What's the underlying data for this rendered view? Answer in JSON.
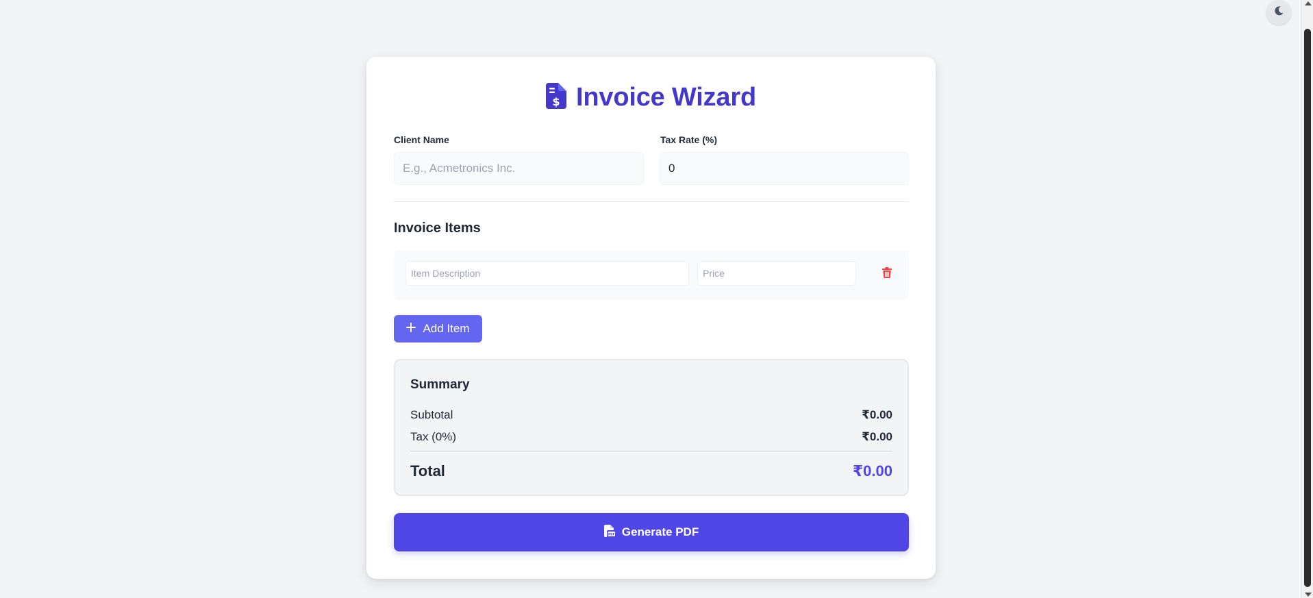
{
  "app": {
    "title": "Invoice Wizard",
    "icon": "file-invoice-dollar-icon",
    "accent_color": "#4338ca"
  },
  "form": {
    "client_name_label": "Client Name",
    "client_name_placeholder": "E.g., Acmetronics Inc.",
    "client_name_value": "",
    "tax_rate_label": "Tax Rate (%)",
    "tax_rate_value": "0"
  },
  "items": {
    "section_title": "Invoice Items",
    "rows": [
      {
        "description_placeholder": "Item Description",
        "description_value": "",
        "price_placeholder": "Price",
        "price_value": ""
      }
    ],
    "add_button_label": "Add Item"
  },
  "summary": {
    "title": "Summary",
    "subtotal_label": "Subtotal",
    "subtotal_value": "₹0.00",
    "tax_label": "Tax (0%)",
    "tax_value": "₹0.00",
    "total_label": "Total",
    "total_value": "₹0.00"
  },
  "actions": {
    "generate_label": "Generate PDF",
    "generate_color": "#4f46e5",
    "add_item_color": "#6366f1",
    "delete_color": "#ef4444"
  },
  "theme_toggle": {
    "icon": "moon-icon"
  }
}
